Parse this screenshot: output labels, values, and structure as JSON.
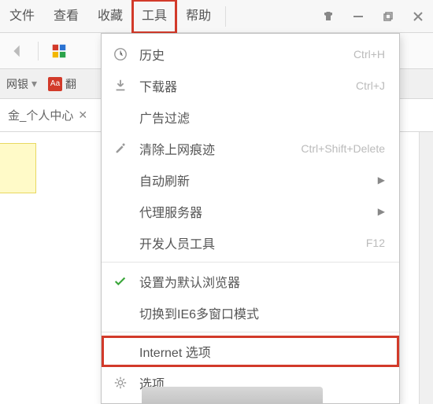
{
  "menubar": {
    "items": [
      "文件",
      "查看",
      "收藏",
      "工具",
      "帮助"
    ],
    "active_index": 3
  },
  "bookmarks": {
    "item1": "网银",
    "item2": "翻"
  },
  "tab": {
    "title_fragment": "金_个人中心"
  },
  "dropdown": {
    "items": [
      {
        "icon": "clock-icon",
        "label": "历史",
        "accel": "Ctrl+H",
        "submenu": false
      },
      {
        "icon": "download-icon",
        "label": "下载器",
        "accel": "Ctrl+J",
        "submenu": false
      },
      {
        "icon": "",
        "label": "广告过滤",
        "accel": "",
        "submenu": false
      },
      {
        "icon": "brush-icon",
        "label": "清除上网痕迹",
        "accel": "Ctrl+Shift+Delete",
        "submenu": false
      },
      {
        "icon": "",
        "label": "自动刷新",
        "accel": "",
        "submenu": true
      },
      {
        "icon": "",
        "label": "代理服务器",
        "accel": "",
        "submenu": true
      },
      {
        "icon": "",
        "label": "开发人员工具",
        "accel": "F12",
        "submenu": false
      },
      {
        "sep": true
      },
      {
        "icon": "check-icon",
        "label": "设置为默认浏览器",
        "accel": "",
        "submenu": false
      },
      {
        "icon": "",
        "label": "切换到IE6多窗口模式",
        "accel": "",
        "submenu": false
      },
      {
        "sep": true
      },
      {
        "icon": "",
        "label": "Internet 选项",
        "accel": "",
        "submenu": false,
        "highlight": true
      },
      {
        "icon": "gear-icon",
        "label": "选项",
        "accel": "",
        "submenu": false
      }
    ]
  }
}
